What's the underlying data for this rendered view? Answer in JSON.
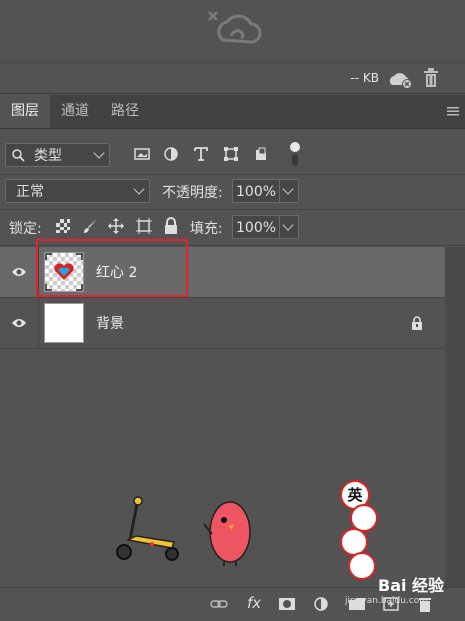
{
  "info": {
    "size": "-- KB"
  },
  "tabs": [
    "图层",
    "通道",
    "路径"
  ],
  "filter": {
    "label": "类型"
  },
  "blend": {
    "mode": "正常",
    "opacity_label": "不透明度:",
    "opacity": "100%"
  },
  "lock": {
    "label": "锁定:",
    "fill_label": "填充:",
    "fill": "100%"
  },
  "layers": [
    {
      "name": "红心 2",
      "selected": true
    },
    {
      "name": "背景",
      "locked": true
    }
  ],
  "bottom": {
    "fx": "fx"
  },
  "watermark": {
    "brand": "Bai 经验",
    "url": "jingyan.baidu.com"
  },
  "sticker": {
    "chars": [
      "英"
    ]
  }
}
